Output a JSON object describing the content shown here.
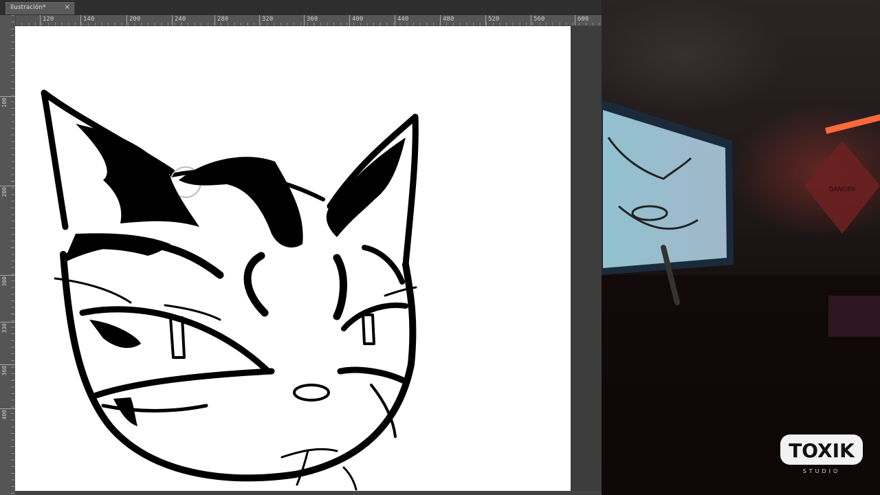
{
  "app": {
    "document_tab": {
      "title": "Ilustración*",
      "close_glyph": "×"
    },
    "ruler_h": [
      "120",
      "140",
      "200",
      "240",
      "280",
      "320",
      "360",
      "400",
      "440",
      "480",
      "520",
      "560",
      "600"
    ],
    "ruler_v": [
      "100",
      "200",
      "300",
      "330",
      "360",
      "400"
    ],
    "canvas_color": "#ffffff",
    "ui_color": "#3a3a3a"
  },
  "webcam": {
    "accent_light": "#ff6a3a",
    "sign_text": "DANGER"
  },
  "watermark": {
    "brand": "TOXIK",
    "sub": "STUDIO"
  }
}
